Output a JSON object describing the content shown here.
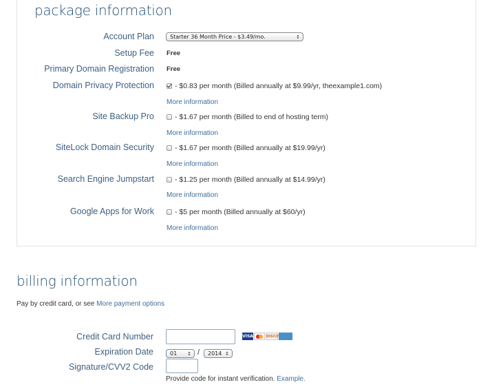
{
  "package": {
    "heading": "package information",
    "rows": [
      {
        "label": "Account Plan"
      },
      {
        "label": "Setup Fee",
        "value": "Free"
      },
      {
        "label": "Primary Domain Registration",
        "value": "Free"
      },
      {
        "label": "Domain Privacy Protection",
        "value": "- $0.83 per month (Billed annually at $9.99/yr, theexample1.com)",
        "checked": true,
        "more": "More information"
      },
      {
        "label": "Site Backup Pro",
        "value": "- $1.67 per month (Billed to end of hosting term)",
        "checked": false,
        "more": "More information"
      },
      {
        "label": "SiteLock Domain Security",
        "value": "- $1.67 per month (Billed annually at $19.99/yr)",
        "checked": false,
        "more": "More information"
      },
      {
        "label": "Search Engine Jumpstart",
        "value": "- $1.25 per month (Billed annually at $14.99/yr)",
        "checked": false,
        "more": "More information"
      },
      {
        "label": "Google Apps for Work",
        "value": "- $5 per month (Billed annually at $60/yr)",
        "checked": false,
        "more": "More information"
      }
    ],
    "plan_select": "Starter 36 Month Price - $3.49/mo."
  },
  "billing": {
    "heading": "billing information",
    "pay_text": "Pay by credit card, or see ",
    "pay_link": "More payment options",
    "cc_label": "Credit Card Number",
    "exp_label": "Expiration Date",
    "exp_month": "01",
    "exp_sep": "/",
    "exp_year": "2014",
    "cvv_label": "Signature/CVV2 Code",
    "cvv_hint": "Provide code for instant verification. ",
    "cvv_link": "Example.",
    "cards": [
      "VISA",
      "DISCOVER"
    ]
  },
  "icons": {
    "select_arrow": "updown-arrow-icon",
    "checkbox": "checkbox-icon"
  }
}
